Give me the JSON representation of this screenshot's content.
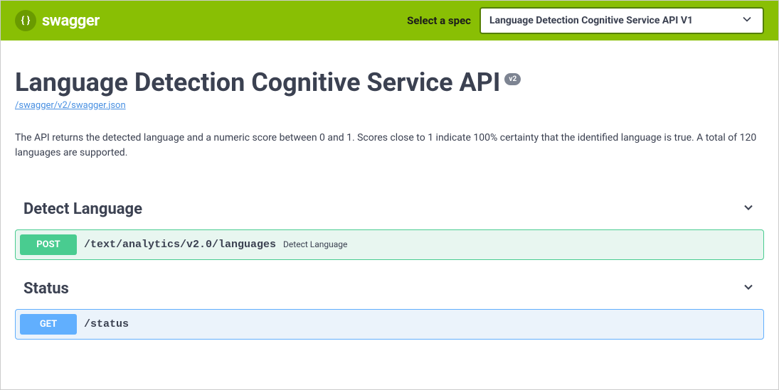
{
  "topbar": {
    "logo_text": "swagger",
    "spec_label": "Select a spec",
    "spec_selected": "Language Detection Cognitive Service API V1"
  },
  "info": {
    "title": "Language Detection Cognitive Service API",
    "version": "v2",
    "spec_url": "/swagger/v2/swagger.json",
    "description": "The API returns the detected language and a numeric score between 0 and 1. Scores close to 1 indicate 100% certainty that the identified language is true. A total of 120 languages are supported."
  },
  "tags": {
    "detect_language": {
      "name": "Detect Language",
      "operations": [
        {
          "method": "POST",
          "path": "/text/analytics/v2.0/languages",
          "summary": "Detect Language"
        }
      ]
    },
    "status": {
      "name": "Status",
      "operations": [
        {
          "method": "GET",
          "path": "/status"
        }
      ]
    }
  }
}
